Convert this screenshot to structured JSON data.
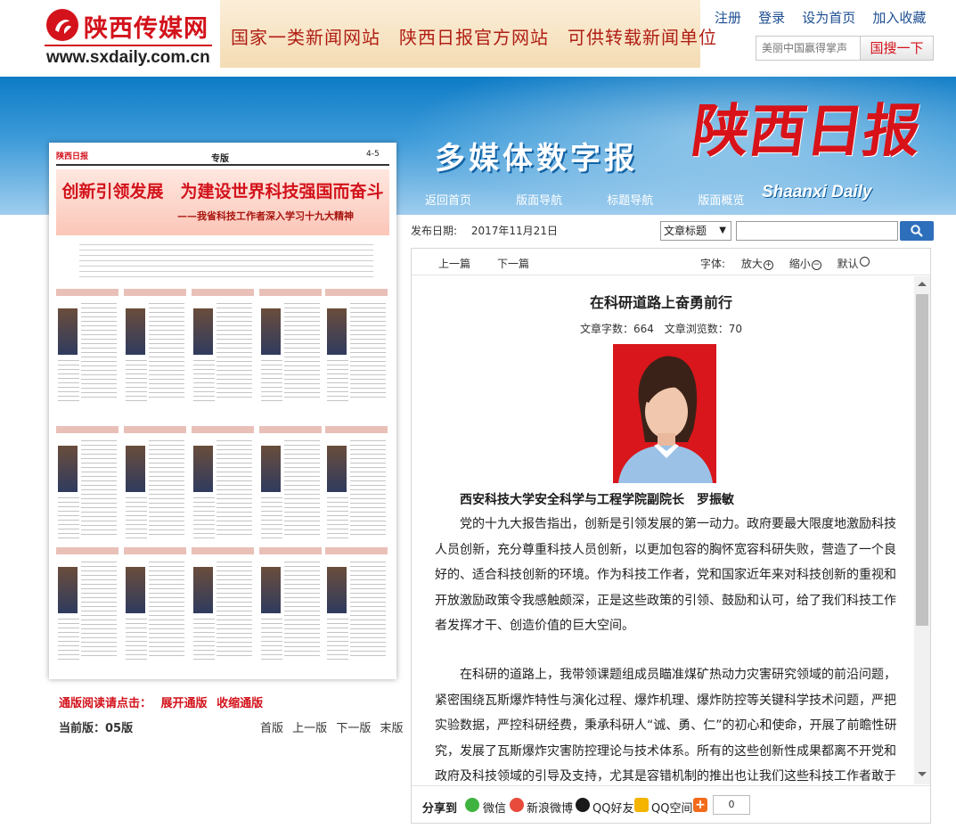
{
  "header": {
    "logo_text": "陕西传媒网",
    "logo_url": "www.sxdaily.com.cn",
    "banner_text": "国家一类新闻网站　陕西日报官方网站　可供转载新闻单位",
    "links": [
      "注册",
      "登录",
      "设为首页",
      "加入收藏"
    ],
    "search_placeholder": "美丽中国赢得掌声",
    "search_button": "国搜一下"
  },
  "band": {
    "media_title": "多媒体数字报",
    "paper_name": "陕西日报",
    "paper_en": "Shaanxi Daily",
    "nav": [
      "返回首页",
      "版面导航",
      "标题导航",
      "版面概览"
    ]
  },
  "thumbnail": {
    "masthead": "陕西日报",
    "section": "专版",
    "page": "4-5",
    "headline": "创新引领发展　为建设世界科技强国而奋斗",
    "subheadline": "——我省科技工作者深入学习十九大精神"
  },
  "edition": {
    "expand_label": "通版阅读请点击：",
    "expand_link": "展开通版",
    "collapse_link": "收缩通版",
    "current_label": "当前版：05版",
    "pager": [
      "首版",
      "上一版",
      "下一版",
      "末版"
    ]
  },
  "search": {
    "pub_label": "发布日期:",
    "pub_date": "2017年11月21日",
    "select_value": "文章标题"
  },
  "article": {
    "prev": "上一篇",
    "next": "下一篇",
    "font_label": "字体:",
    "zoom_in": "放大",
    "zoom_out": "缩小",
    "default": "默认",
    "title": "在科研道路上奋勇前行",
    "word_count": "文章字数：664",
    "view_count": "文章浏览数：70",
    "byline": "西安科技大学安全科学与工程学院副院长　罗振敏",
    "paragraphs": [
      "党的十九大报告指出，创新是引领发展的第一动力。政府要最大限度地激励科技人员创新，充分尊重科技人员创新，以更加包容的胸怀宽容科研失败，营造了一个良好的、适合科技创新的环境。作为科技工作者，党和国家近年来对科技创新的重视和开放激励政策令我感触颇深，正是这些政策的引领、鼓励和认可，给了我们科技工作者发挥才干、创造价值的巨大空间。",
      "在科研的道路上，我带领课题组成员瞄准煤矿热动力灾害研究领域的前沿问题，紧密围绕瓦斯爆炸特性与演化过程、爆炸机理、爆炸防控等关键科学技术问题，严把实验数据，严控科研经费，秉承科研人“诚、勇、仁”的初心和使命，开展了前瞻性研究，发展了瓦斯爆炸灾害防控理论与技术体系。所有的这些创新性成果都离不开党和政府及科技领域的引导及支持，尤其是容错机制的推出也让我们这些科技工作者敢于放手大胆去开展研究。这些年，我先后承担了国家重点研发计划子课题、国家自然"
    ]
  },
  "share": {
    "label": "分享到",
    "items": [
      "微信",
      "新浪微博",
      "QQ好友",
      "QQ空间"
    ],
    "count": "0"
  }
}
